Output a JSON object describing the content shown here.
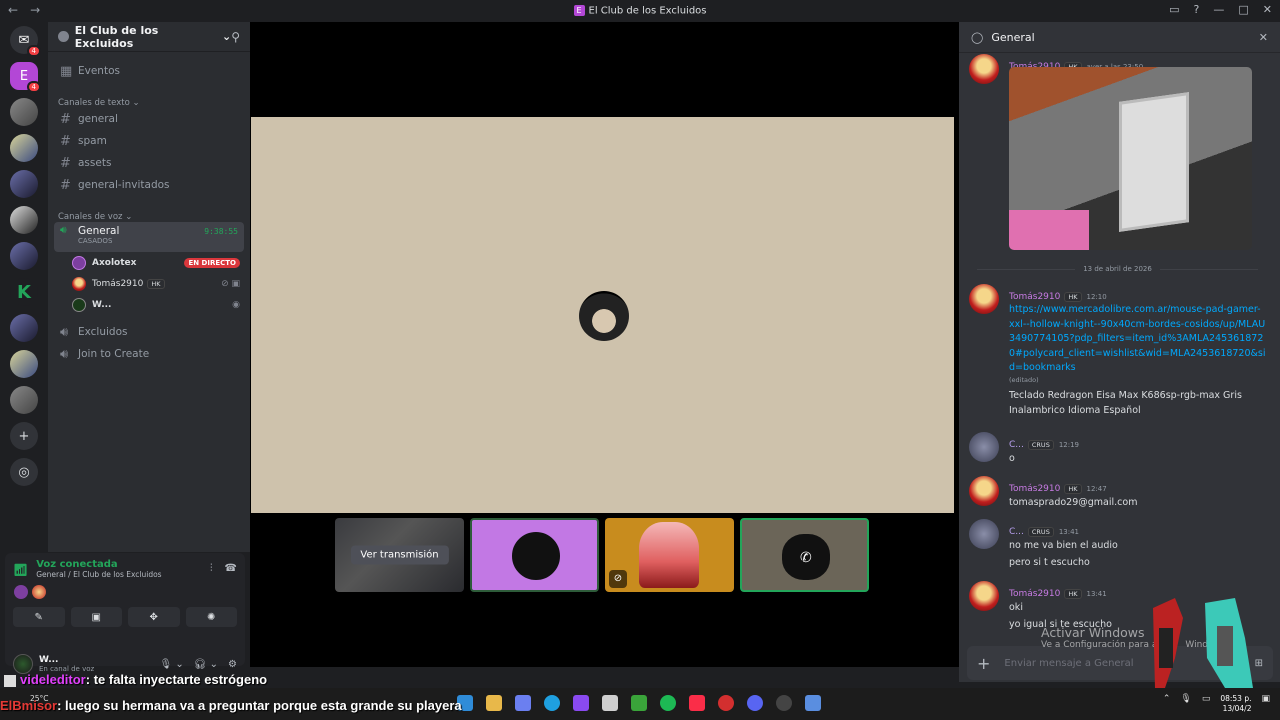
{
  "window": {
    "title": "El Club de los Excluidos",
    "back": "←",
    "forward": "→"
  },
  "guilds": {
    "discord_badge": "4",
    "selected_badge": "4"
  },
  "server": {
    "name": "El Club de los Excluidos"
  },
  "sidebar": {
    "events": "Eventos",
    "text_category": "Canales de texto",
    "text_channels": [
      "general",
      "spam",
      "assets",
      "general-invitados"
    ],
    "voice_category": "Canales de voz",
    "voice_channel": {
      "name": "General",
      "status": "CASADOS",
      "timer": "9:38:55"
    },
    "voice_users": [
      {
        "name": "Axolotex",
        "live": "EN DIRECTO"
      },
      {
        "name": "Tomás2910",
        "tag": "HK"
      },
      {
        "name": "W..."
      }
    ],
    "other_voice": [
      "Excluidos",
      "Join to Create"
    ]
  },
  "voice_panel": {
    "status": "Voz conectada",
    "location": "General / El Club de los Excluidos"
  },
  "userbar": {
    "name": "W...",
    "status": "En canal de voz"
  },
  "stage": {
    "watch_label": "Ver transmisión"
  },
  "chat": {
    "title": "General",
    "messages": [
      {
        "author": "Tomás2910",
        "tag": "HK",
        "time": "ayer a las 23:50"
      },
      {
        "divider": "13 de abril de 2026"
      },
      {
        "author": "Tomás2910",
        "tag": "HK",
        "time": "12:10",
        "link": "https://www.mercadolibre.com.ar/mouse-pad-gamer-xxl--hollow-knight--90x40cm-bordes-cosidos/up/MLAU3490774105?pdp_filters=item_id%3AMLA2453618720#polycard_client=wishlist&wid=MLA2453618720&sid=bookmarks",
        "edited": "(editado)",
        "text": "Teclado Redragon Eisa Max K686sp-rgb-max Gris Inalambrico Idioma Español"
      },
      {
        "author": "C...",
        "tag": "CRUS",
        "time": "12:19",
        "text": "o"
      },
      {
        "author": "Tomás2910",
        "tag": "HK",
        "time": "12:47",
        "text": "tomasprado29@gmail.com"
      },
      {
        "author": "C...",
        "tag": "CRUS",
        "time": "13:41",
        "lines": [
          "no me va bien el audio",
          "pero si t escucho"
        ]
      },
      {
        "author": "Tomás2910",
        "tag": "HK",
        "time": "13:41",
        "lines": [
          "oki",
          "yo igual si te escucho"
        ]
      }
    ],
    "placeholder": "Enviar mensaje a General"
  },
  "watermark": {
    "title": "Activar Windows",
    "subtitle": "Ve a Configuración para a",
    "subtitle_end": "Wind"
  },
  "stream_chat": [
    {
      "user": "videleditor",
      "text": ": te falta inyectarte estrógeno"
    },
    {
      "user": "ElBmisor",
      "text": ": luego su hermana va a preguntar porque esta grande su playera"
    }
  ],
  "taskbar": {
    "temp": "25°C",
    "time": "08:53 p.",
    "date": "13/04/2"
  }
}
